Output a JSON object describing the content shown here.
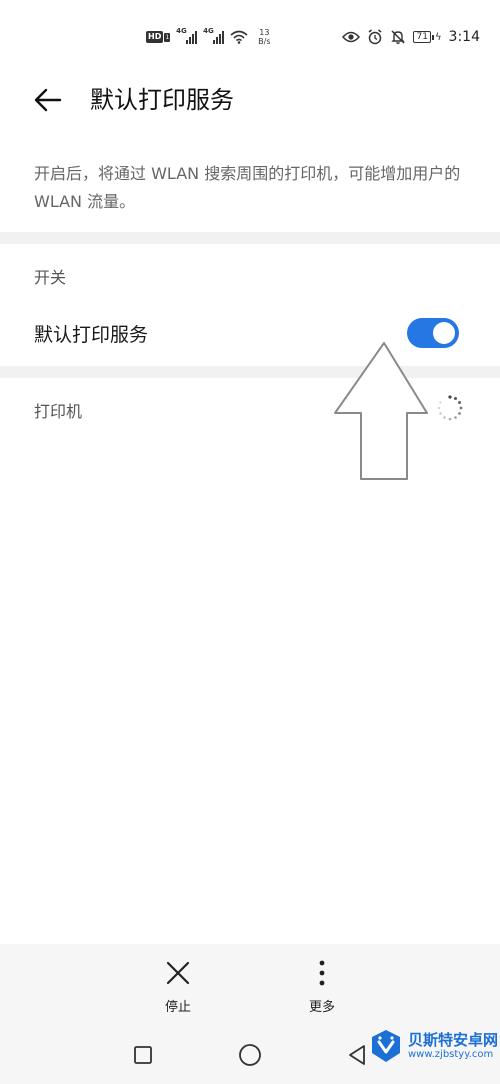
{
  "status_bar": {
    "hd": "HD",
    "hd_sub": "1",
    "signal1_gen": "4G",
    "signal2_gen": "4G",
    "net_speed_value": "13",
    "net_speed_unit": "B/s",
    "battery": "71",
    "time": "3:14"
  },
  "header": {
    "title": "默认打印服务"
  },
  "description": "开启后，将通过 WLAN 搜索周围的打印机，可能增加用户的 WLAN 流量。",
  "switch_section": {
    "header": "开关",
    "row_label": "默认打印服务",
    "enabled": true
  },
  "printer_section": {
    "header": "打印机"
  },
  "actions": {
    "stop_label": "停止",
    "more_label": "更多"
  },
  "watermark": {
    "name": "贝斯特安卓网",
    "url": "www.zjbstyy.com"
  },
  "colors": {
    "accent": "#2577e4",
    "watermark": "#1c6fd4"
  }
}
